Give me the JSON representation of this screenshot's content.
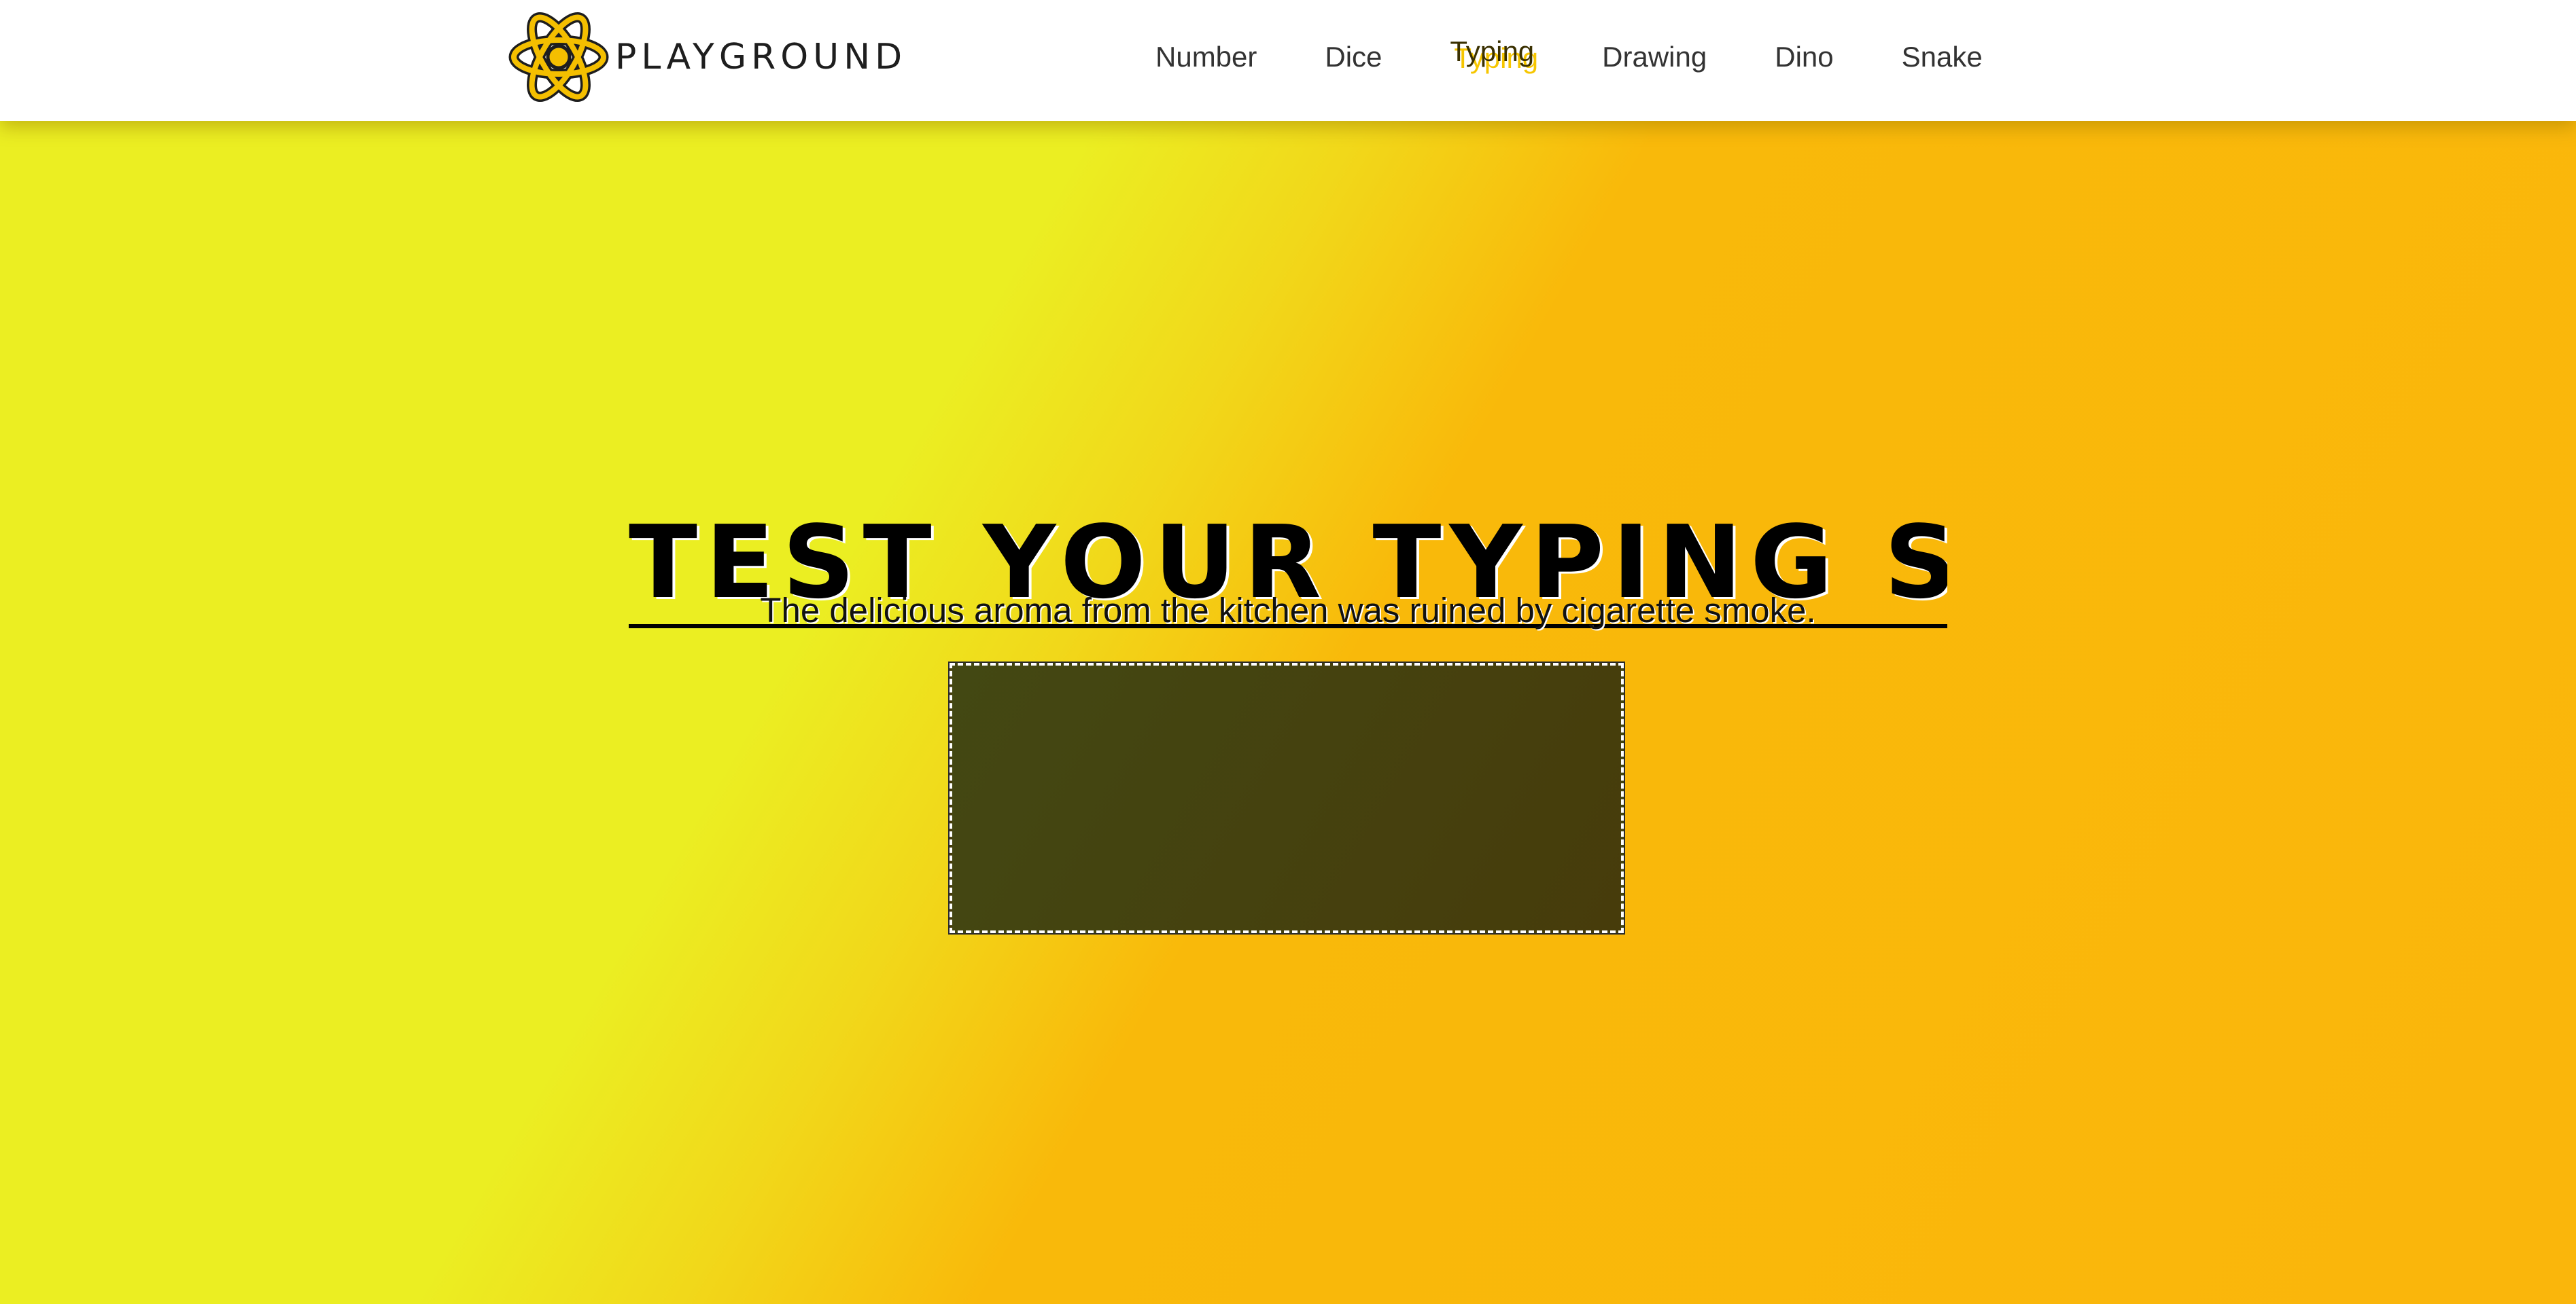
{
  "brand": {
    "name": "PLAYGROUND",
    "logo_icon": "atom-icon"
  },
  "nav": {
    "items": [
      {
        "label": "Number"
      },
      {
        "label": "Dice"
      },
      {
        "label": "Typing",
        "active": true
      },
      {
        "label": "Drawing"
      },
      {
        "label": "Dino"
      },
      {
        "label": "Snake"
      }
    ]
  },
  "hero": {
    "title": "TEST YOUR TYPING SP",
    "cursor": "|",
    "sentence": "The delicious aroma from the kitchen was ruined by cigarette smoke.",
    "input_value": ""
  },
  "colors": {
    "background_left": "#ebee22",
    "background_right": "#fab60b",
    "nav_active_accent": "#f6c600",
    "typing_box": "#454312"
  }
}
